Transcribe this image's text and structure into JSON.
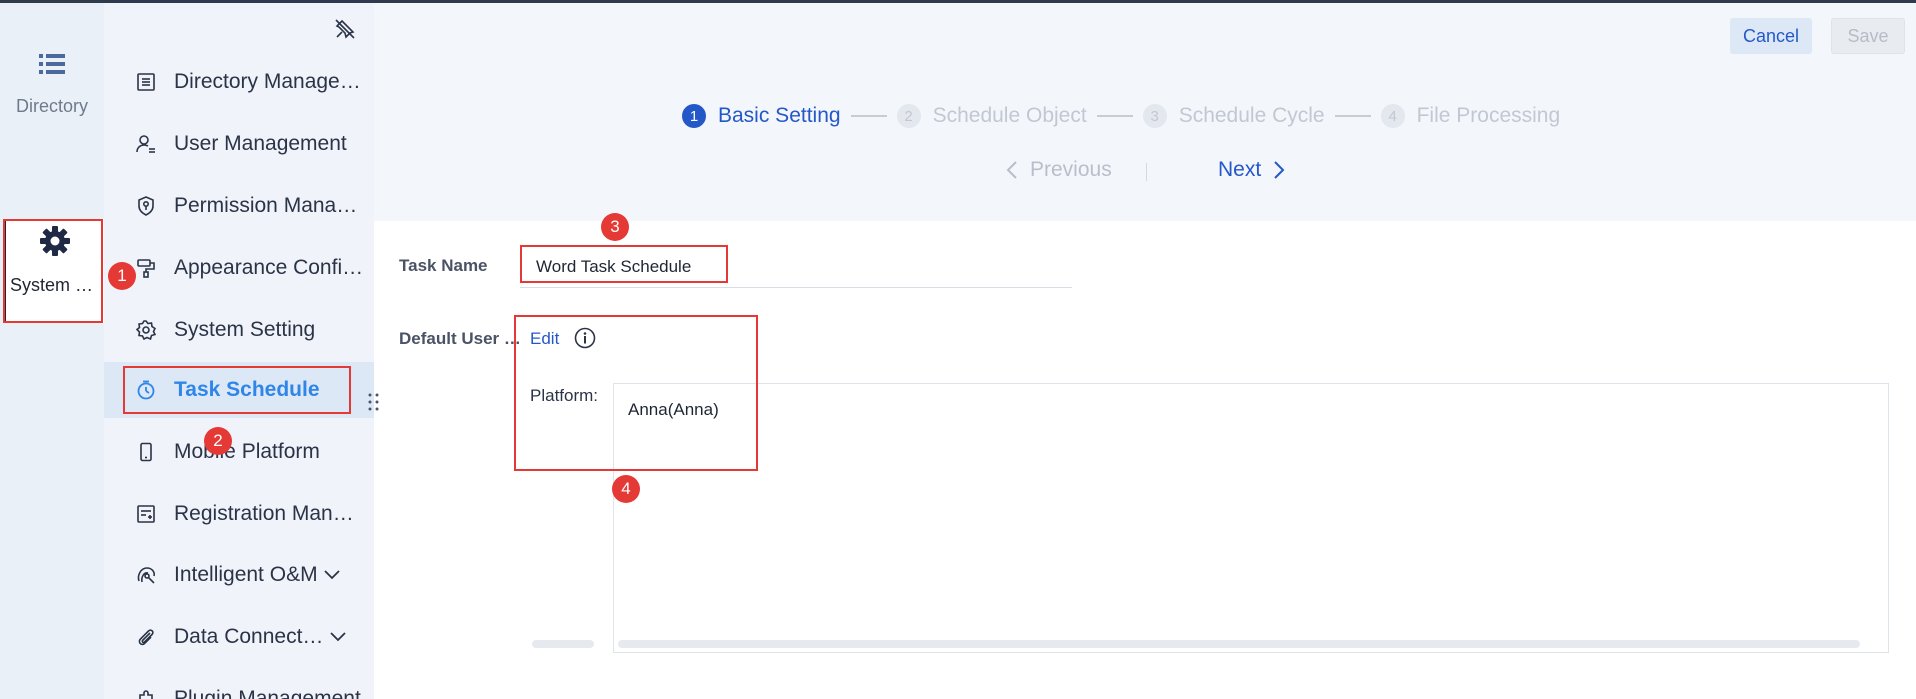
{
  "rail": {
    "directory_label": "Directory",
    "system_label": "System Management"
  },
  "menu": {
    "items": [
      {
        "label": "Directory Management",
        "icon": "list-doc-icon"
      },
      {
        "label": "User Management",
        "icon": "user-list-icon"
      },
      {
        "label": "Permission Management",
        "icon": "shield-key-icon"
      },
      {
        "label": "Appearance Configuration",
        "icon": "paint-roller-icon"
      },
      {
        "label": "System Setting",
        "icon": "gear-icon"
      },
      {
        "label": "Task Schedule",
        "icon": "stopwatch-icon"
      },
      {
        "label": "Mobile Platform",
        "icon": "mobile-icon"
      },
      {
        "label": "Registration Management",
        "icon": "register-icon"
      },
      {
        "label": "Intelligent O&M",
        "icon": "intelligent-om-icon"
      },
      {
        "label": "Data Connection",
        "icon": "paperclip-icon"
      },
      {
        "label": "Plugin Management",
        "icon": "plugin-icon"
      }
    ],
    "active_index": 5
  },
  "toolbar": {
    "cancel_label": "Cancel",
    "save_label": "Save"
  },
  "steps": [
    {
      "num": "1",
      "label": "Basic Setting",
      "state": "current"
    },
    {
      "num": "2",
      "label": "Schedule Object",
      "state": "todo"
    },
    {
      "num": "3",
      "label": "Schedule Cycle",
      "state": "todo"
    },
    {
      "num": "4",
      "label": "File Processing",
      "state": "todo"
    }
  ],
  "nav": {
    "previous_label": "Previous",
    "next_label": "Next"
  },
  "form": {
    "task_name_label": "Task Name",
    "task_name_value": "Word Task Schedule",
    "default_user_label": "Default User Setting",
    "edit_label": "Edit",
    "platform_label": "Platform:",
    "platform_value": "Anna(Anna)"
  },
  "annotations": [
    "1",
    "2",
    "3",
    "4"
  ],
  "colors": {
    "accent": "#2458c9",
    "active_menu": "#2f86e8",
    "annotation_red": "#e53935"
  }
}
